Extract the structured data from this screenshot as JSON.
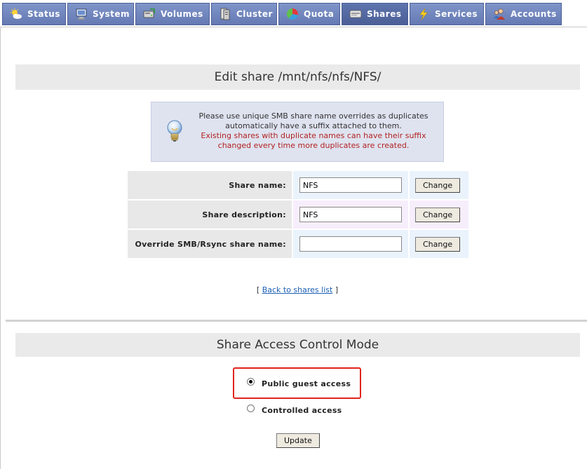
{
  "tabs": [
    {
      "label": "Status",
      "icon": "status-icon"
    },
    {
      "label": "System",
      "icon": "system-icon"
    },
    {
      "label": "Volumes",
      "icon": "volumes-icon"
    },
    {
      "label": "Cluster",
      "icon": "cluster-icon"
    },
    {
      "label": "Quota",
      "icon": "quota-icon"
    },
    {
      "label": "Shares",
      "icon": "shares-icon",
      "active": true
    },
    {
      "label": "Services",
      "icon": "services-icon"
    },
    {
      "label": "Accounts",
      "icon": "accounts-icon"
    }
  ],
  "edit": {
    "title": "Edit share /mnt/nfs/nfs/NFS/",
    "info_line1": "Please use unique SMB share name overrides as duplicates automatically have a suffix attached to them.",
    "info_line2": "Existing shares with duplicate names can have their suffix changed every time more duplicates are created.",
    "rows": [
      {
        "label": "Share name:",
        "value": "NFS",
        "button": "Change"
      },
      {
        "label": "Share description:",
        "value": "NFS",
        "button": "Change"
      },
      {
        "label": "Override SMB/Rsync share name:",
        "value": "",
        "button": "Change"
      }
    ],
    "back_prefix": "[",
    "back_link": "Back to shares list",
    "back_suffix": "]"
  },
  "access": {
    "title": "Share Access Control Mode",
    "options": [
      {
        "label": "Public guest access",
        "selected": true
      },
      {
        "label": "Controlled access",
        "selected": false
      }
    ],
    "update_label": "Update"
  },
  "colors": {
    "tab_bg": "#7086c0",
    "tab_active_bg": "#56699f",
    "warning_text": "#b22222",
    "highlight_border": "#e0241b",
    "link": "#1a5fb4"
  }
}
